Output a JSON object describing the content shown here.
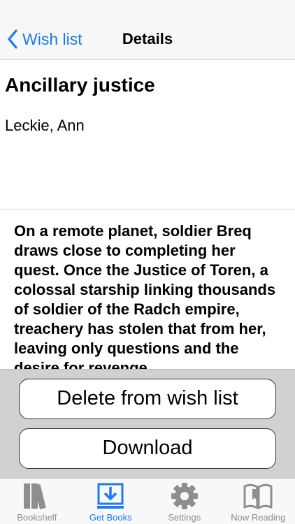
{
  "navbar": {
    "back_label": "Wish list",
    "title": "Details"
  },
  "book": {
    "title": "Ancillary justice",
    "author": "Leckie, Ann",
    "description": "On a remote planet, soldier Breq draws close to completing her quest. Once the Justice of Toren, a colossal starship linking thousands of soldier of the Radch empire, treachery has stolen that from her, leaving only questions and the desire for revenge."
  },
  "actions": {
    "delete_label": "Delete from wish list",
    "download_label": "Download"
  },
  "tabbar": {
    "tabs": [
      {
        "label": "Bookshelf",
        "icon": "bookshelf-icon",
        "active": false
      },
      {
        "label": "Get Books",
        "icon": "download-tray-icon",
        "active": true
      },
      {
        "label": "Settings",
        "icon": "gear-icon",
        "active": false
      },
      {
        "label": "Now Reading",
        "icon": "open-book-icon",
        "active": false
      }
    ]
  },
  "colors": {
    "accent": "#1a7bf2",
    "inactive": "#8e8e8e"
  }
}
